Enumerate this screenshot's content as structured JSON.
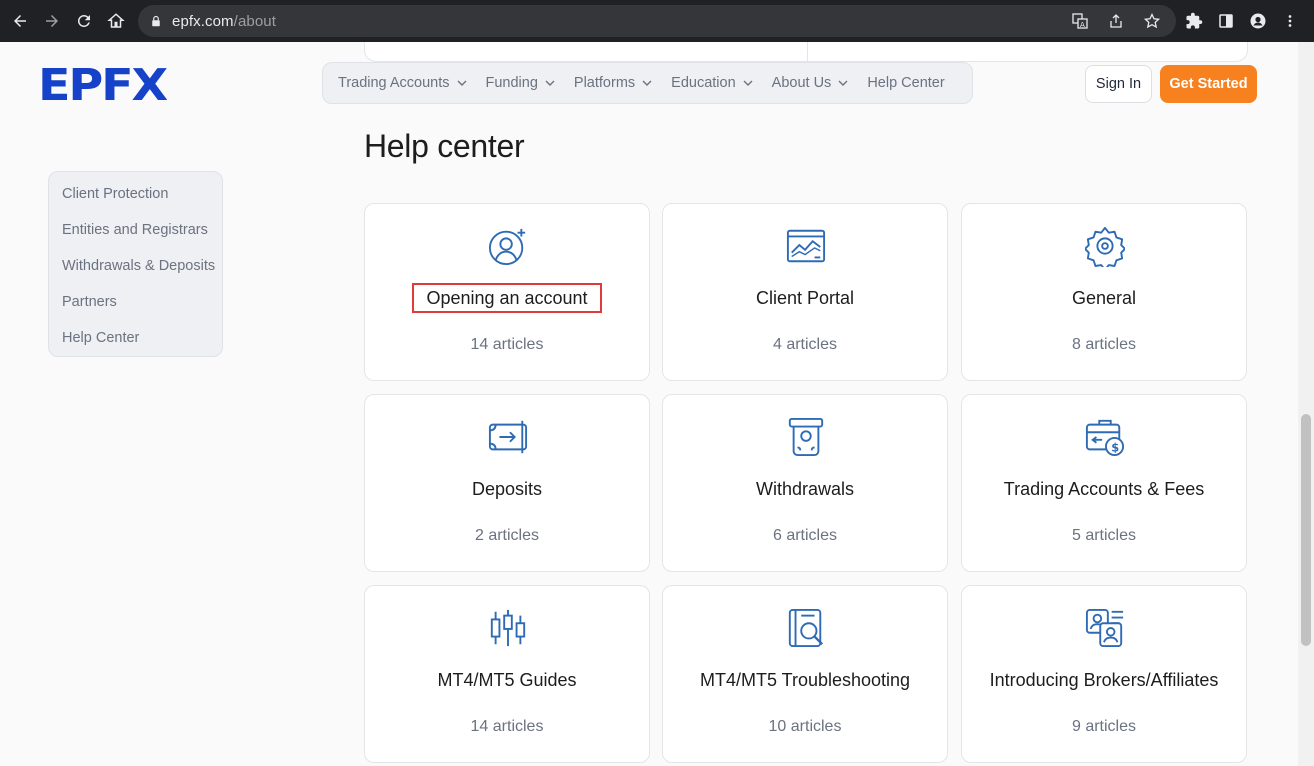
{
  "browser": {
    "url_domain": "epfx.com",
    "url_path": "/about"
  },
  "header": {
    "logo_text": "EPFX",
    "nav": [
      {
        "label": "Trading Accounts",
        "dropdown": true
      },
      {
        "label": "Funding",
        "dropdown": true
      },
      {
        "label": "Platforms",
        "dropdown": true
      },
      {
        "label": "Education",
        "dropdown": true
      },
      {
        "label": "About Us",
        "dropdown": true
      },
      {
        "label": "Help Center",
        "dropdown": false
      }
    ],
    "signin_label": "Sign In",
    "cta_label": "Get Started"
  },
  "sidebar": {
    "items": [
      {
        "label": "Client Protection"
      },
      {
        "label": "Entities and Registrars"
      },
      {
        "label": "Withdrawals & Deposits"
      },
      {
        "label": "Partners"
      },
      {
        "label": "Help Center"
      }
    ]
  },
  "main": {
    "title": "Help center",
    "cards": [
      {
        "title": "Opening an account",
        "count": "14 articles",
        "icon": "user-add-icon",
        "highlighted": true
      },
      {
        "title": "Client Portal",
        "count": "4 articles",
        "icon": "chart-window-icon"
      },
      {
        "title": "General",
        "count": "8 articles",
        "icon": "gear-icon"
      },
      {
        "title": "Deposits",
        "count": "2 articles",
        "icon": "wallet-in-icon"
      },
      {
        "title": "Withdrawals",
        "count": "6 articles",
        "icon": "cash-out-icon"
      },
      {
        "title": "Trading Accounts & Fees",
        "count": "5 articles",
        "icon": "briefcase-money-icon"
      },
      {
        "title": "MT4/MT5 Guides",
        "count": "14 articles",
        "icon": "candlestick-icon"
      },
      {
        "title": "MT4/MT5 Troubleshooting",
        "count": "10 articles",
        "icon": "book-search-icon"
      },
      {
        "title": "Introducing Brokers/Affiliates",
        "count": "9 articles",
        "icon": "people-card-icon"
      }
    ]
  },
  "colors": {
    "accent_blue": "#1641c9",
    "icon_blue": "#2f6bb5",
    "cta_orange": "#f7811e",
    "highlight_red": "#e03a3a"
  }
}
